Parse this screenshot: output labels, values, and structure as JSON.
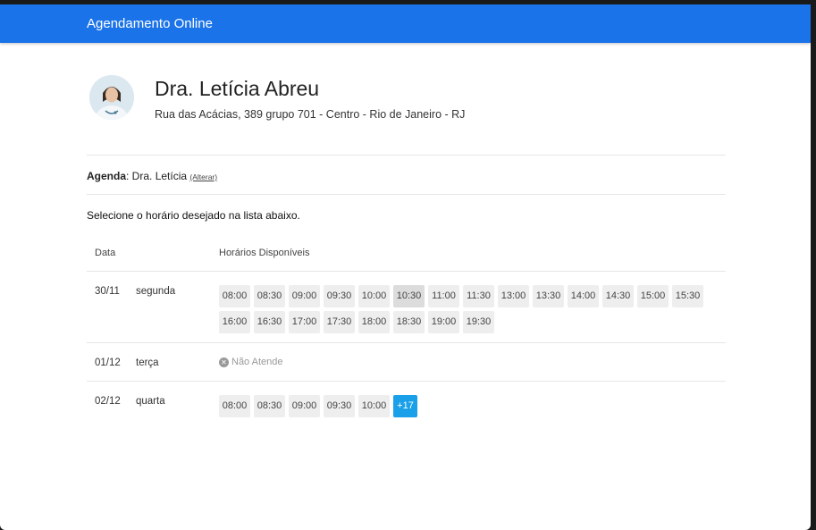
{
  "header": {
    "title": "Agendamento Online"
  },
  "doctor": {
    "name": "Dra. Letícia Abreu",
    "address": "Rua das Acácias, 389 grupo 701 - Centro - Rio de Janeiro - RJ"
  },
  "agenda": {
    "label": "Agenda",
    "value": ": Dra. Letícia ",
    "change_link": "(Alterar)"
  },
  "instruction": "Selecione o horário desejado na lista abaixo.",
  "table": {
    "col_date": "Data",
    "col_slots": "Horários Disponíveis"
  },
  "rows": [
    {
      "date": "30/11",
      "day": "segunda",
      "slots": [
        "08:00",
        "08:30",
        "09:00",
        "09:30",
        "10:00",
        "10:30",
        "11:00",
        "11:30",
        "13:00",
        "13:30",
        "14:00",
        "14:30",
        "15:00",
        "15:30",
        "16:00",
        "16:30",
        "17:00",
        "17:30",
        "18:00",
        "18:30",
        "19:00",
        "19:30"
      ],
      "highlighted": "10:30"
    },
    {
      "date": "01/12",
      "day": "terça",
      "no_service": "Não Atende"
    },
    {
      "date": "02/12",
      "day": "quarta",
      "slots": [
        "08:00",
        "08:30",
        "09:00",
        "09:30",
        "10:00"
      ],
      "more": "+17"
    }
  ],
  "colors": {
    "header_bg": "#1a73e8",
    "more_badge": "#1aa0e8"
  }
}
